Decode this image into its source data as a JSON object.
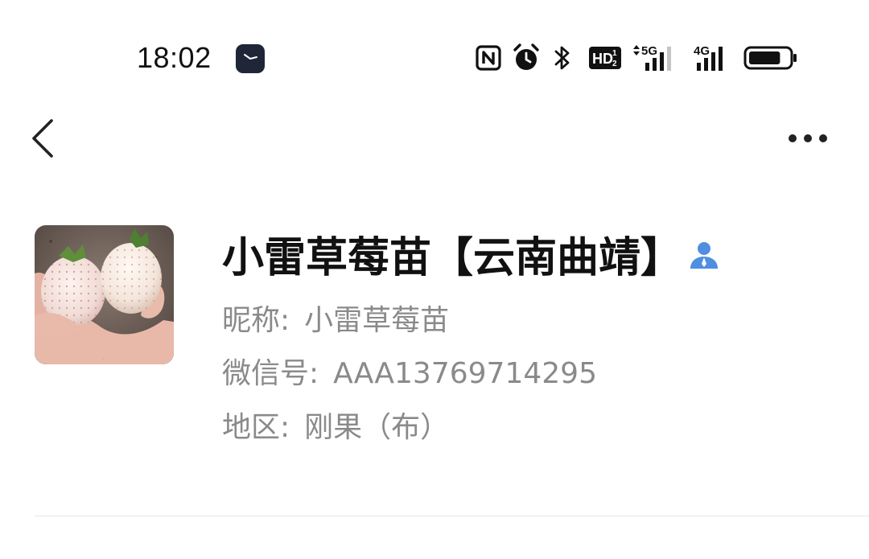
{
  "status_bar": {
    "time": "18:02",
    "app_icon": "watch-clock-icon",
    "icons": [
      "nfc-icon",
      "alarm-icon",
      "bluetooth-icon",
      "hd-volte-icon",
      "5g-signal-icon",
      "4g-signal-icon",
      "battery-icon"
    ],
    "hd_label": "HD",
    "hd_sub_top": "1",
    "hd_sub_bottom": "2",
    "network_1": "5G",
    "network_2": "4G",
    "battery_percent": 80
  },
  "nav": {
    "back_icon": "chevron-left-icon",
    "more_icon": "more-horizontal-icon"
  },
  "profile": {
    "avatar_icon": "avatar-photo-strawberries",
    "display_name": "小雷草莓苗【云南曲靖】",
    "contact_icon": "contact-person-icon",
    "nickname_label": "昵称:",
    "nickname": "小雷草莓苗",
    "wechat_id_label": "微信号:",
    "wechat_id": "AAA13769714295",
    "region_label": "地区:",
    "region": "刚果（布）"
  },
  "colors": {
    "text_primary": "#111111",
    "text_secondary": "#8a8a8a",
    "contact_icon_blue": "#4f8fe0",
    "divider": "#e8e8e8"
  }
}
